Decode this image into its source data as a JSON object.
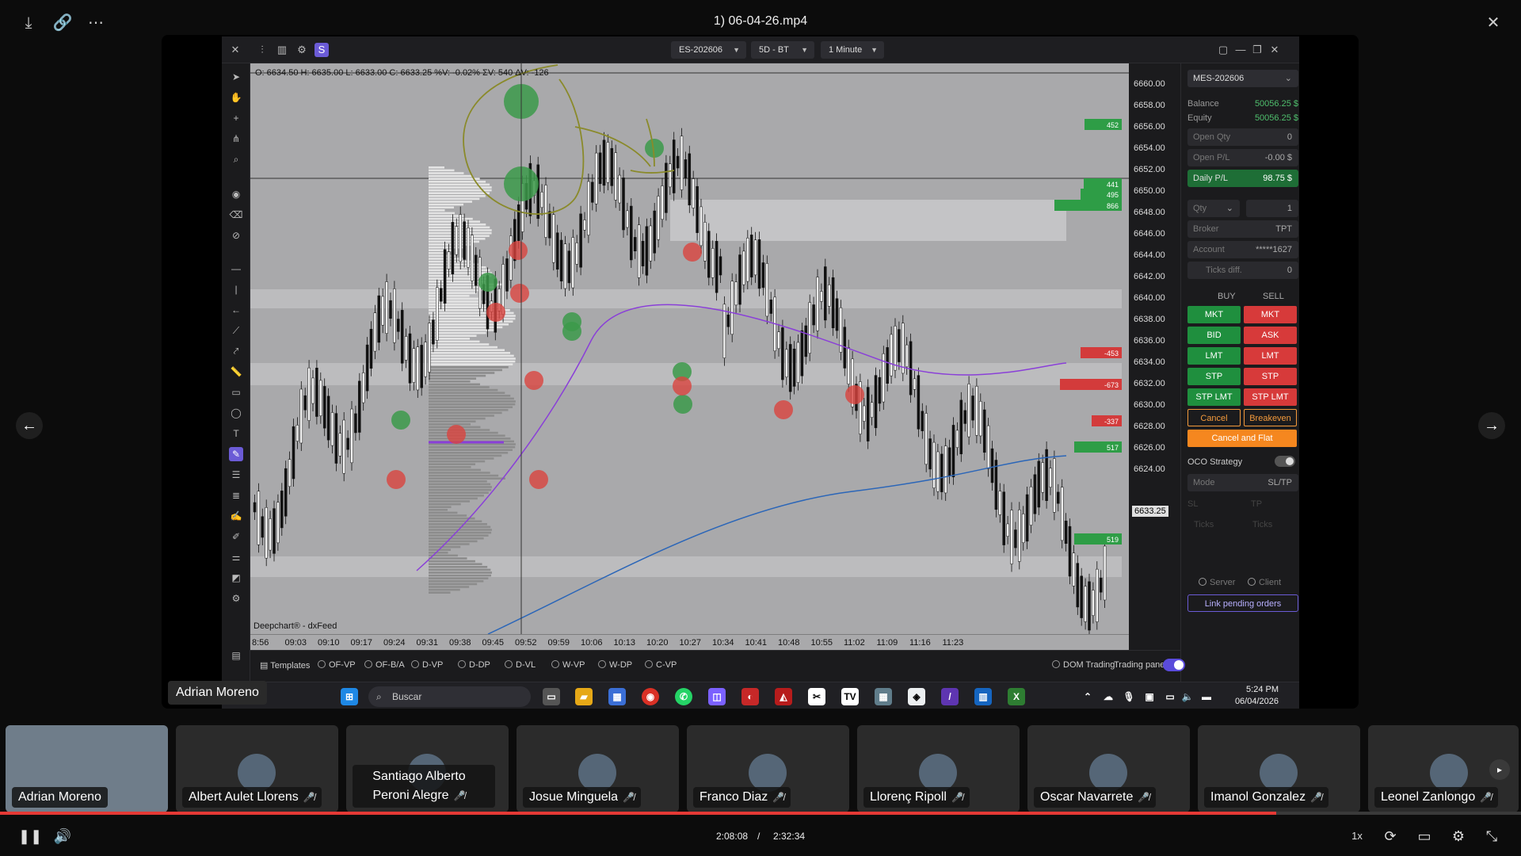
{
  "viewer": {
    "title": "1) 06-04-26.mp4",
    "icons": [
      "download-icon",
      "link-icon",
      "more-icon",
      "close-icon"
    ]
  },
  "app": {
    "header": {
      "symbol": "ES-202606",
      "timeframe": "5D - BT",
      "interval": "1 Minute"
    },
    "chart": {
      "ohlc_text": "O: 6634.50  H: 6635.00  L: 6633.00  C: 6633.25  %V: -0.02%  ΣV: 540  ΔV: -126",
      "credit": "Deepchart® - dxFeed",
      "price_labels": [
        "6660.00",
        "6658.00",
        "6656.00",
        "6654.00",
        "6652.00",
        "6650.00",
        "6648.00",
        "6646.00",
        "6644.00",
        "6642.00",
        "6640.00",
        "6638.00",
        "6636.00",
        "6634.00",
        "6632.00",
        "6630.00",
        "6628.00",
        "6626.00",
        "6624.00"
      ],
      "current_price": "6633.25",
      "time_labels": [
        "8:56",
        "09:03",
        "09:10",
        "09:17",
        "09:24",
        "09:31",
        "09:38",
        "09:45",
        "09:52",
        "09:59",
        "10:06",
        "10:13",
        "10:20",
        "10:27",
        "10:34",
        "10:41",
        "10:48",
        "10:55",
        "11:02",
        "11:09",
        "11:16",
        "11:23"
      ],
      "dom_values": [
        "452",
        "441",
        "495",
        "866",
        "-453",
        "-673",
        "-337",
        "517",
        "519"
      ]
    },
    "bottom_bar": {
      "templates": "Templates",
      "options": [
        "OF-VP",
        "OF-B/A",
        "D-VP",
        "D-DP",
        "D-VL",
        "W-VP",
        "W-DP",
        "C-VP"
      ],
      "dom_trading": "DOM Trading",
      "trading_panel": "Trading panel"
    },
    "trade_panel": {
      "instrument": "MES-202606",
      "balance_label": "Balance",
      "balance_value": "50056.25 $",
      "equity_label": "Equity",
      "equity_value": "50056.25 $",
      "open_qty_label": "Open Qty",
      "open_qty_value": "0",
      "open_pl_label": "Open P/L",
      "open_pl_value": "-0.00 $",
      "daily_pl_label": "Daily P/L",
      "daily_pl_value": "98.75 $",
      "qty_label": "Qty",
      "qty_value": "1",
      "broker_label": "Broker",
      "broker_value": "TPT",
      "account_label": "Account",
      "account_value": "*****1627",
      "ticks_label": "Ticks diff.",
      "ticks_value": "0",
      "buy_label": "BUY",
      "sell_label": "SELL",
      "buy_buttons": [
        "MKT",
        "BID",
        "LMT",
        "STP",
        "STP LMT"
      ],
      "sell_buttons": [
        "MKT",
        "ASK",
        "LMT",
        "STP",
        "STP LMT"
      ],
      "cancel": "Cancel",
      "breakeven": "Breakeven",
      "cancel_flat": "Cancel and Flat",
      "oco": "OCO Strategy",
      "mode_label": "Mode",
      "mode_value": "SL/TP",
      "sl": "SL",
      "tp": "TP",
      "ticks1": "Ticks",
      "ticks2": "Ticks",
      "server": "Server",
      "client": "Client",
      "link_pending": "Link pending orders"
    },
    "taskbar": {
      "search": "Buscar",
      "time": "5:24 PM",
      "date": "06/04/2026"
    }
  },
  "meeting": {
    "speaker": "Adrian Moreno",
    "participants": [
      {
        "name": "Adrian Moreno",
        "muted": false
      },
      {
        "name": "Albert Aulet Llorens",
        "muted": true
      },
      {
        "name": "Santiago Alberto Peroni Alegre",
        "muted": true
      },
      {
        "name": "Josue Minguela",
        "muted": true
      },
      {
        "name": "Franco Diaz",
        "muted": true
      },
      {
        "name": "Llorenç Ripoll",
        "muted": true
      },
      {
        "name": "Oscar Navarrete",
        "muted": true
      },
      {
        "name": "Imanol Gonzalez",
        "muted": true
      },
      {
        "name": "Leonel Zanlongo",
        "muted": true
      }
    ]
  },
  "player": {
    "current_time": "2:08:08",
    "separator": "/",
    "duration": "2:32:34",
    "speed": "1x",
    "progress_fraction": 0.839
  },
  "colors": {
    "buy": "#1f8f3e",
    "sell": "#d73a3a",
    "accent": "#f39a3c",
    "progress": "#e53935"
  }
}
